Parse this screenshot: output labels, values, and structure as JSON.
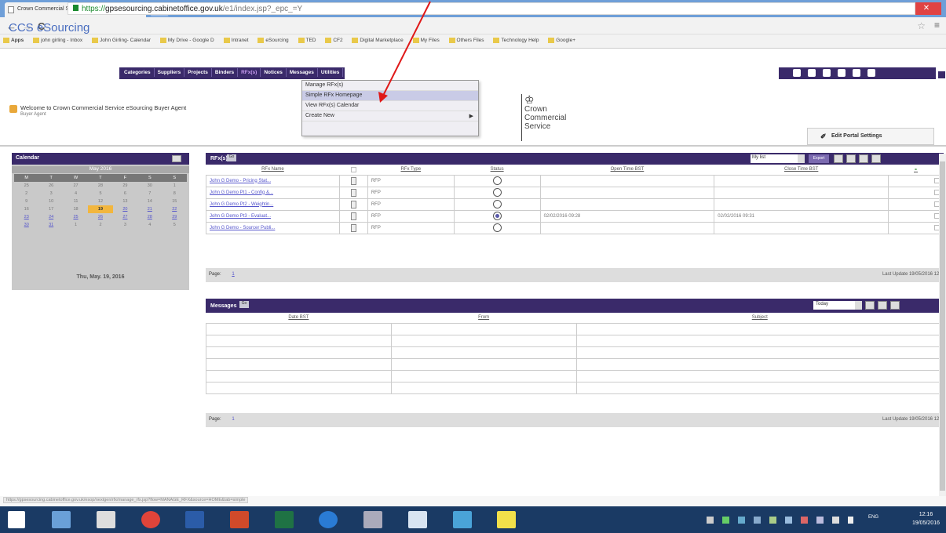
{
  "browser": {
    "tab_title": "Crown Commercial Servi...",
    "tab_close": "✕",
    "url_https": "https://",
    "url_host": "gpsesourcing.cabinetoffice.gov.uk",
    "url_path": "/e1/index.jsp?_epc_=Y",
    "bookmarks": [
      "Apps",
      "john girling - Inbox",
      "John Girling- Calendar",
      "My Drive - Google D",
      "Intranet",
      "eSourcing",
      "TED",
      "CF2",
      "Digital Marketplace",
      "My Files",
      "Others Files",
      "Technology Help",
      "Google+"
    ],
    "back": "←",
    "forward": "→",
    "reload": "C",
    "star": "☆",
    "menu": "≡",
    "win_min": "–",
    "win_max": "❐",
    "win_close": "✕"
  },
  "app": {
    "logo": "CCS eSourcing",
    "nav": [
      "Categories",
      "Suppliers",
      "Projects",
      "Binders",
      "RFx(s)",
      "Notices",
      "Messages",
      "Utilities"
    ],
    "active_nav": "RFx(s)",
    "welcome": "Welcome to Crown Commercial Service eSourcing Buyer Agent",
    "welcome_sub": "Buyer Agent",
    "crown_lines": [
      "Crown",
      "Commercial",
      "Service"
    ],
    "edit_portal": "Edit Portal Settings"
  },
  "dropdown": {
    "items": [
      "Manage RFx(s)",
      "Simple RFx Homepage",
      "View RFx(s) Calendar",
      "Create New"
    ],
    "highlighted_index": 1
  },
  "calendar": {
    "title": "Calendar",
    "month": "May 2016",
    "dow": [
      "M",
      "T",
      "W",
      "T",
      "F",
      "S",
      "S"
    ],
    "weeks": [
      [
        "25",
        "26",
        "27",
        "28",
        "29",
        "30",
        "1"
      ],
      [
        "2",
        "3",
        "4",
        "5",
        "6",
        "7",
        "8"
      ],
      [
        "9",
        "10",
        "11",
        "12",
        "13",
        "14",
        "15"
      ],
      [
        "16",
        "17",
        "18",
        "19",
        "20",
        "21",
        "22"
      ],
      [
        "23",
        "24",
        "25",
        "26",
        "27",
        "28",
        "29"
      ],
      [
        "30",
        "31",
        "1",
        "2",
        "3",
        "4",
        "5"
      ]
    ],
    "today": "19",
    "selected_date": "Thu, May. 19, 2016"
  },
  "rfx": {
    "title": "RFx(s)",
    "go": "Go",
    "list_select": "My list",
    "export": "Export",
    "columns": [
      "RFx Name",
      "",
      "RFx Type",
      "Status",
      "Open Time BST",
      "Close Time BST",
      ""
    ],
    "rows": [
      {
        "name": "John G Demo - Pricing Stat...",
        "type": "RFP",
        "status_on": false,
        "open": "",
        "close": ""
      },
      {
        "name": "John G Demo Pt1 - Config &...",
        "type": "RFP",
        "status_on": false,
        "open": "",
        "close": ""
      },
      {
        "name": "John G Demo Pt2 - Weightin...",
        "type": "RFP",
        "status_on": false,
        "open": "",
        "close": ""
      },
      {
        "name": "John G Demo Pt3 - Evaluat...",
        "type": "RFP",
        "status_on": true,
        "open": "02/02/2016 09:28",
        "close": "02/02/2016 09:31"
      },
      {
        "name": "John G Demo - Sourcer Publi...",
        "type": "RFP",
        "status_on": false,
        "open": "",
        "close": ""
      }
    ],
    "page_label": "Page:",
    "page_num": "1",
    "last_update": "Last Update 19/05/2016 12:"
  },
  "messages": {
    "title": "Messages",
    "go": "Go",
    "filter": "Today",
    "columns": [
      "Date BST",
      "From",
      "Subject"
    ],
    "empty_rows": 6,
    "page_label": "Page:",
    "page_num": "1",
    "last_update": "Last Update 19/05/2016 12:"
  },
  "statusbar": {
    "url": "https://gpsesourcing.cabinetoffice.gov.uk/esop/nextgen/rfx/manage_rfx.jsp?flow=MANAGE_RFX&source=HOME&tab=simple"
  },
  "taskbar": {
    "time": "12:16",
    "date": "19/05/2016",
    "lang": "ENG"
  }
}
